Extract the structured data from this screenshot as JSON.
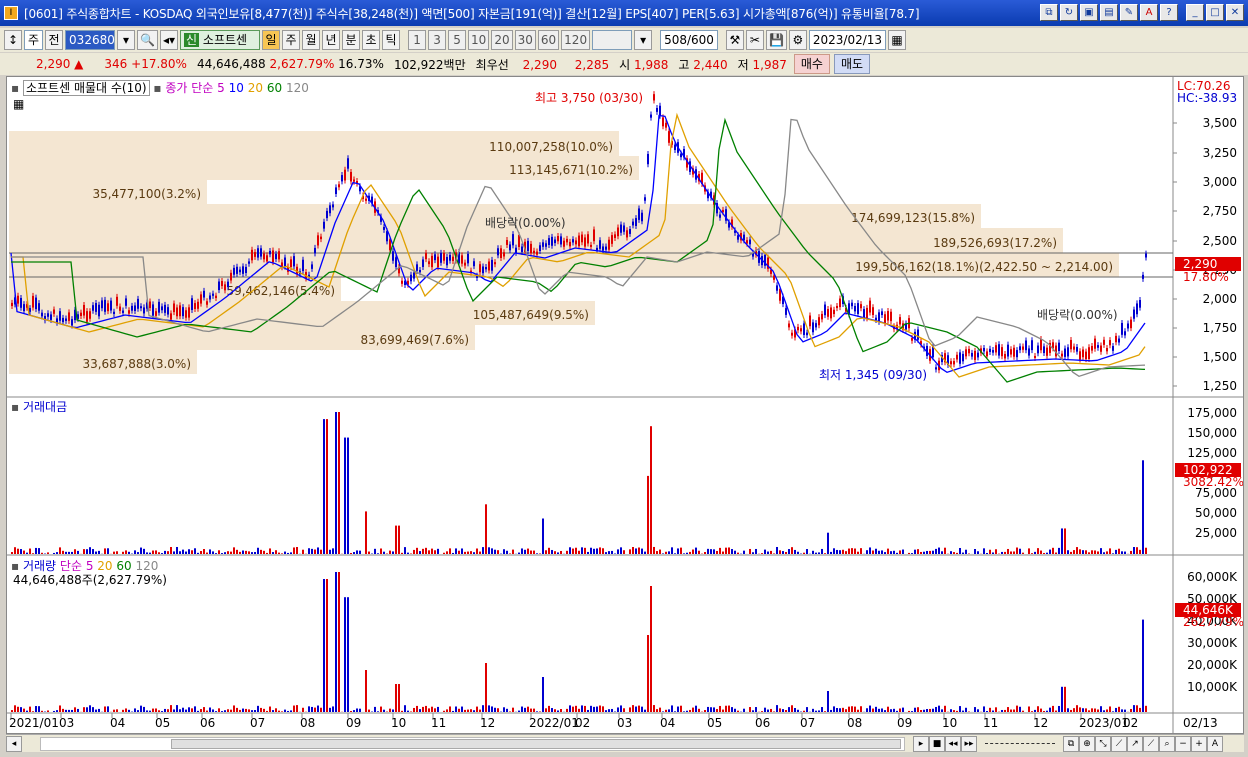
{
  "window": {
    "title": "[0601] 주식종합차트 - KOSDAQ 외국인보유[8,477(천)] 주식수[38,248(천)] 액면[500] 자본금[191(억)] 결산[12월] EPS[407] PER[5.63] 시가총액[876(억)] 유통비율[78.7]"
  },
  "toolbar": {
    "period_unit": "주",
    "prev_label": "전",
    "stock_code": "032680",
    "stock_name_badge": "신",
    "stock_name": "소프트센",
    "period_buttons": [
      "일",
      "주",
      "월",
      "년",
      "분",
      "초",
      "틱"
    ],
    "active_period": "일",
    "interval_buttons": [
      "1",
      "3",
      "5",
      "10",
      "20",
      "30",
      "60",
      "120"
    ],
    "count": "508",
    "count_total": "/600",
    "date": "2023/02/13"
  },
  "quote": {
    "price": "2,290",
    "change": "346",
    "change_pct": "+17.80%",
    "volume": "44,646,488",
    "volume_pct": "2,627.79%",
    "turnover": "16.73%",
    "amount": "102,922백만",
    "best_ask_label": "최우선",
    "ask": "2,290",
    "bid": "2,285",
    "open_label": "시",
    "open": "1,988",
    "high_label": "고",
    "high": "2,440",
    "low_label": "저",
    "low": "1,987",
    "buy_label": "매수",
    "sell_label": "매도"
  },
  "price_pane": {
    "legend_title": "소프트센 매물대 수(10)",
    "ma_label": "종가 단순 5",
    "ma_periods": [
      "10",
      "20",
      "60",
      "120"
    ],
    "ma_colors": [
      "#c000c0",
      "#0000ff",
      "#e0a000",
      "#008000",
      "#888888"
    ],
    "lc": "LC:70.26",
    "hc": "HC:-38.93",
    "y_ticks": [
      "3,500",
      "3,250",
      "3,000",
      "2,750",
      "2,500",
      "2,250",
      "2,000",
      "1,750",
      "1,500",
      "1,250"
    ],
    "current_price_tag": "2,290",
    "current_pct_tag": "17.80%",
    "high_annotation": "최고 3,750 (03/30)",
    "low_annotation": "최저 1,345 (09/30)",
    "dividend_label": "배당락(0.00%)",
    "volume_profile": [
      {
        "label": "110,007,258(10.0%)"
      },
      {
        "label": "113,145,671(10.2%)"
      },
      {
        "label": "35,477,100(3.2%)"
      },
      {
        "label": "174,699,123(15.8%)"
      },
      {
        "label": "189,526,693(17.2%)"
      },
      {
        "label": "199,506,162(18.1%)(2,422.50 ~ 2,214.00)"
      },
      {
        "label": "59,462,146(5.4%)"
      },
      {
        "label": "105,487,649(9.5%)"
      },
      {
        "label": "83,699,469(7.6%)"
      },
      {
        "label": "33,687,888(3.0%)"
      }
    ]
  },
  "amount_pane": {
    "title": "거래대금",
    "y_ticks": [
      "175,000",
      "150,000",
      "125,000",
      "100,000",
      "75,000",
      "50,000",
      "25,000"
    ],
    "current_tag": "102,922",
    "current_pct": "3082.42%"
  },
  "volume_pane": {
    "title": "거래량",
    "ma_label": "단순 5",
    "ma_periods": [
      "20",
      "60",
      "120"
    ],
    "current_text": "44,646,488주(2,627.79%)",
    "y_ticks": [
      "60,000K",
      "50,000K",
      "40,000K",
      "30,000K",
      "20,000K",
      "10,000K"
    ],
    "current_tag": "44,646K",
    "current_pct": "2627.79%"
  },
  "x_axis": {
    "labels": [
      "2021/01",
      "03",
      "04",
      "05",
      "06",
      "07",
      "08",
      "09",
      "10",
      "11",
      "12",
      "2022/01",
      "02",
      "03",
      "04",
      "05",
      "06",
      "07",
      "08",
      "09",
      "10",
      "11",
      "12",
      "2023/01",
      "02"
    ],
    "right_label": "02/13"
  }
}
